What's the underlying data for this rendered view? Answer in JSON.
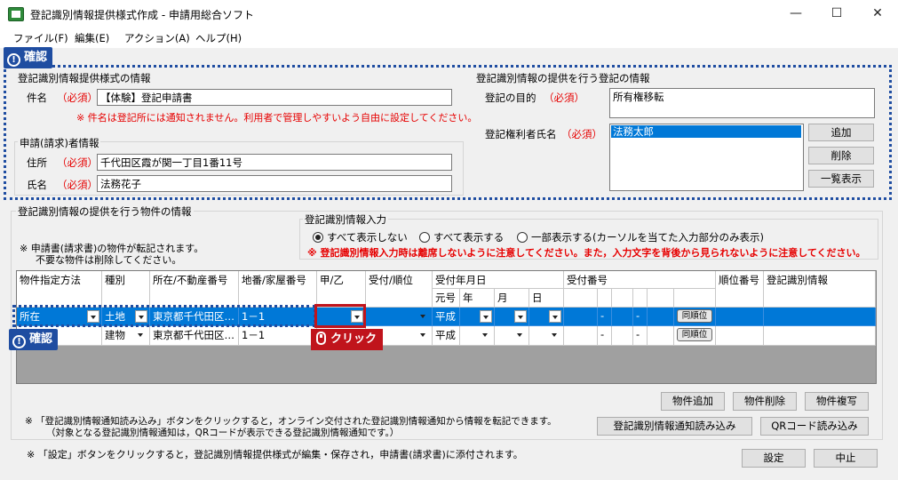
{
  "window": {
    "title": "登記識別情報提供様式作成 - 申請用総合ソフト",
    "minimize": "—",
    "maximize": "☐",
    "close": "✕"
  },
  "menu": [
    "ファイル(F)",
    "編集(E)",
    "アクション(A)",
    "ヘルプ(H)"
  ],
  "annotations": {
    "confirm": "確認",
    "click": "クリック",
    "confirm_icon": "!"
  },
  "provision_info": {
    "title": "登記識別情報提供様式の情報",
    "subject_label": "件名",
    "required": "（必須）",
    "subject_value": "【体験】登記申請書",
    "subject_note": "※ 件名は登記所には通知されません。利用者で管理しやすいよう自由に設定してください。"
  },
  "applicant": {
    "title": "申請(請求)者情報",
    "address_label": "住所",
    "address_value": "千代田区霞が関一丁目1番11号",
    "name_label": "氏名",
    "name_value": "法務花子"
  },
  "registration": {
    "title": "登記識別情報の提供を行う登記の情報",
    "purpose_label": "登記の目的",
    "purpose_value": "所有権移転",
    "holder_label": "登記権利者氏名",
    "holder_value": "法務太郎",
    "add_button": "追加",
    "delete_button": "削除",
    "list_button": "一覧表示"
  },
  "property": {
    "title": "登記識別情報の提供を行う物件の情報",
    "note_line1": "※ 申請書(請求書)の物件が転記されます。",
    "note_line2": "不要な物件は削除してください。",
    "input_group_title": "登記識別情報入力",
    "radio_all_hidden": "すべて表示しない",
    "radio_all_shown": "すべて表示する",
    "radio_partial": "一部表示する(カーソルを当てた入力部分のみ表示)",
    "warning": "※ 登記識別情報入力時は離席しないように注意してください。また，入力文字を背後から見られないように注意してください。",
    "headers": {
      "method": "物件指定方法",
      "type": "種別",
      "location": "所在/不動産番号",
      "lot": "地番/家屋番号",
      "kou_otsu": "甲/乙",
      "receipt_order": "受付/順位",
      "receipt_date": "受付年月日",
      "era": "元号",
      "year": "年",
      "month": "月",
      "day": "日",
      "receipt_no": "受付番号",
      "rank_no": "順位番号",
      "id_info": "登記識別情報"
    },
    "rows": [
      {
        "method": "所在",
        "type": "土地",
        "location": "東京都千代田区…",
        "lot": "1－1",
        "era": "平成",
        "dash1": "-",
        "dash2": "-",
        "same_rank": "同順位"
      },
      {
        "method": "",
        "type": "建物",
        "location": "東京都千代田区…",
        "lot": "1－1",
        "era": "平成",
        "dash1": "-",
        "dash2": "-",
        "same_rank": "同順位"
      }
    ],
    "add_button": "物件追加",
    "delete_button": "物件削除",
    "copy_button": "物件複写",
    "notice_line1": "※ 「登記識別情報通知読み込み」ボタンをクリックすると，オンライン交付された登記識別情報通知から情報を転記できます。",
    "notice_line2": "（対象となる登記識別情報通知は，QRコードが表示できる登記識別情報通知です。）",
    "read_notice_button": "登記識別情報通知読み込み",
    "qr_button": "QRコード読み込み"
  },
  "footer": {
    "note": "※ 「設定」ボタンをクリックすると，登記識別情報提供様式が編集・保存され，申請書(請求書)に添付されます。",
    "settings_button": "設定",
    "cancel_button": "中止"
  }
}
